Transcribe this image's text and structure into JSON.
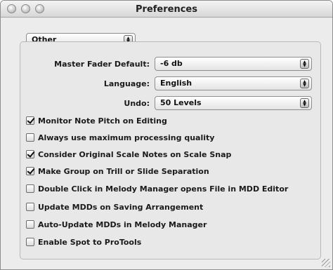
{
  "window": {
    "title": "Preferences"
  },
  "category": {
    "selected": "Other"
  },
  "fields": {
    "master_fader": {
      "label": "Master Fader Default:",
      "value": "-6 db"
    },
    "language": {
      "label": "Language:",
      "value": "English"
    },
    "undo": {
      "label": "Undo:",
      "value": "50 Levels"
    }
  },
  "options": [
    {
      "label": "Monitor Note Pitch on Editing",
      "checked": true
    },
    {
      "label": "Always use maximum processing quality",
      "checked": false
    },
    {
      "label": "Consider Original Scale Notes on Scale Snap",
      "checked": true
    },
    {
      "label": "Make Group on Trill or Slide Separation",
      "checked": true
    },
    {
      "label": "Double Click in Melody Manager opens File in MDD Editor",
      "checked": false
    },
    {
      "label": "Update MDDs on Saving Arrangement",
      "checked": false
    },
    {
      "label": "Auto-Update MDDs in Melody Manager",
      "checked": false
    },
    {
      "label": "Enable Spot to ProTools",
      "checked": false
    }
  ],
  "icons": {
    "close": "close-button-icon",
    "minimize": "minimize-button-icon",
    "zoom": "zoom-button-icon",
    "popup_arrows": "updown-arrows-icon",
    "resize": "resize-grip-icon"
  }
}
